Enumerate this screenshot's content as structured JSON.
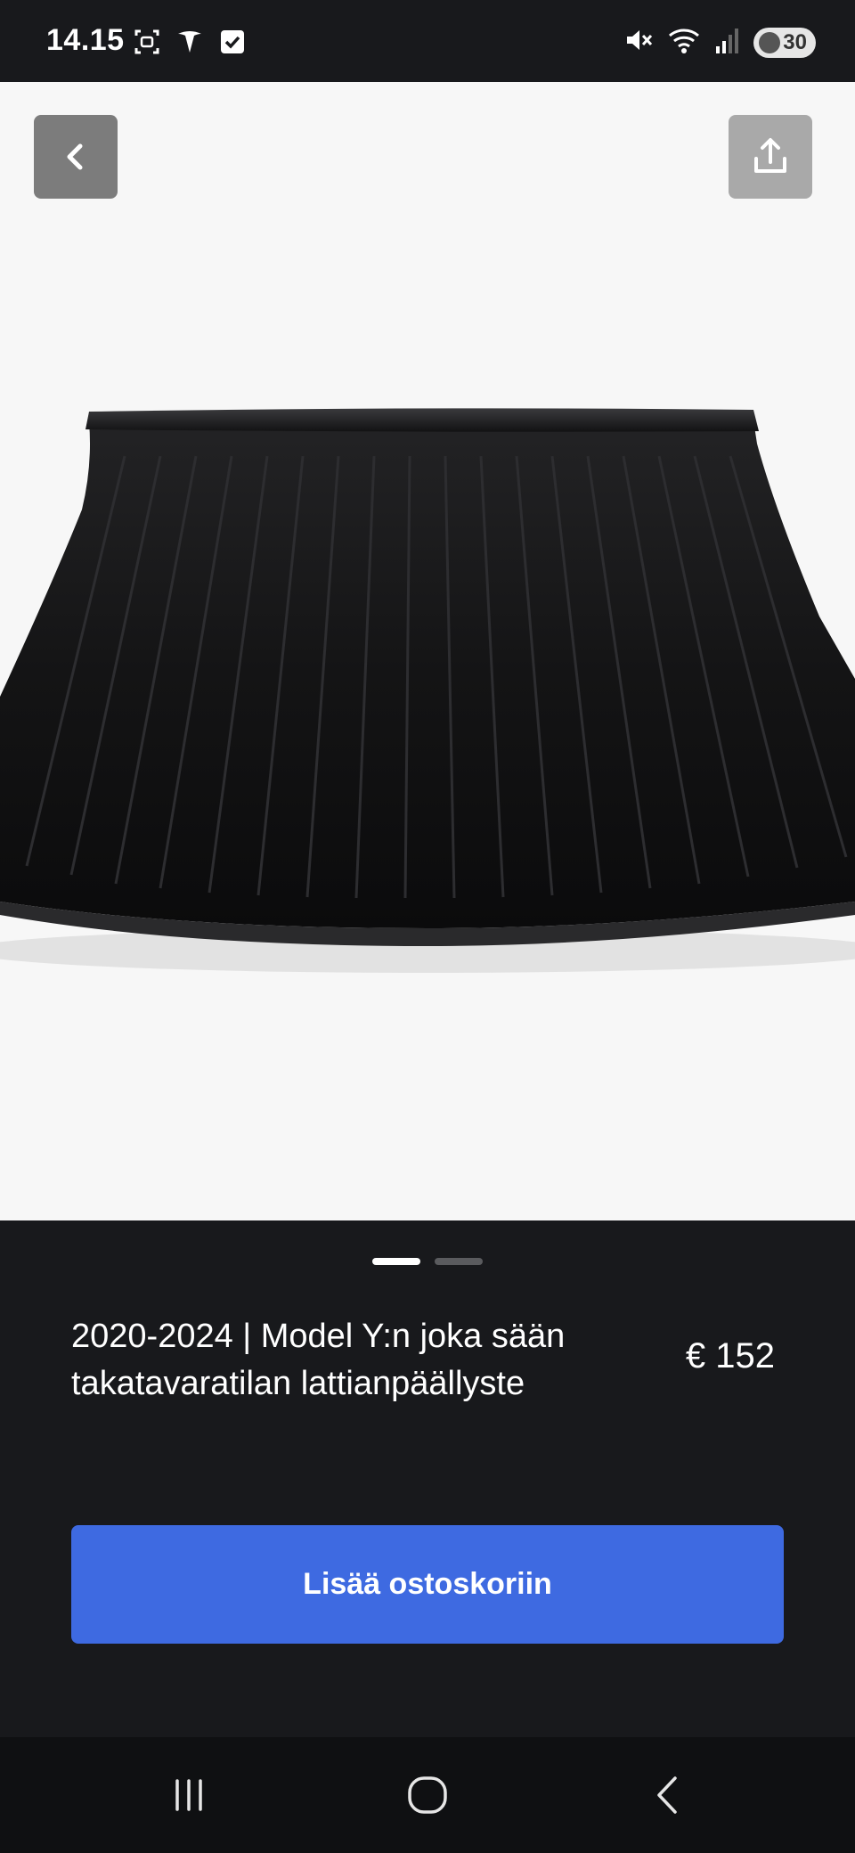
{
  "status_bar": {
    "time": "14.15",
    "icons_left": [
      "screenshot-icon",
      "tesla-logo-icon",
      "checkbox-icon"
    ],
    "icons_right": [
      "mute-icon",
      "wifi-icon",
      "signal-icon"
    ],
    "battery": "30"
  },
  "toolbar": {
    "back_icon": "chevron-left-icon",
    "share_icon": "share-icon"
  },
  "gallery": {
    "image_alt": "Model Y rear cargo floor mat",
    "page_count": 2,
    "active_page": 1
  },
  "product": {
    "title": "2020-2024 | Model Y:n joka sään takatavaratilan lattianpäällyste",
    "price": "€ 152"
  },
  "actions": {
    "add_to_cart_label": "Lisää ostoskoriin"
  },
  "colors": {
    "accent": "#3e6ae1",
    "panel_bg": "#18191c",
    "image_bg": "#f7f7f7"
  }
}
